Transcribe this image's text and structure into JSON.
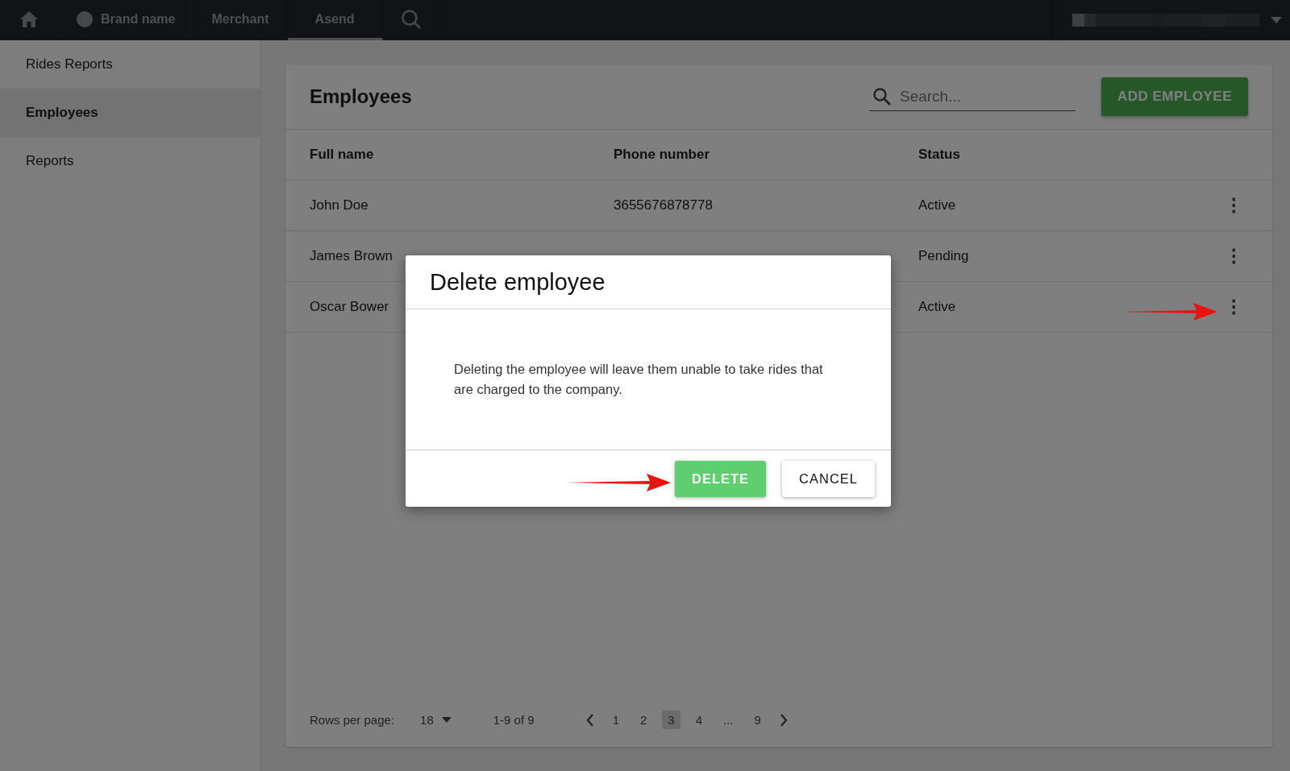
{
  "nav": {
    "brand": "Brand name",
    "tabs": [
      {
        "label": "Merchant",
        "selected": false
      },
      {
        "label": "Asend",
        "selected": true
      }
    ]
  },
  "sidebar": {
    "items": [
      {
        "label": "Rides Reports",
        "selected": false
      },
      {
        "label": "Employees",
        "selected": true
      },
      {
        "label": "Reports",
        "selected": false
      }
    ]
  },
  "page": {
    "title": "Employees",
    "search": {
      "placeholder": "Search..."
    },
    "add_button": "ADD EMPLOYEE"
  },
  "table": {
    "columns": [
      "Full name",
      "Phone number",
      "Status"
    ],
    "rows": [
      {
        "full_name": "John Doe",
        "phone": "3655676878778",
        "status": "Active"
      },
      {
        "full_name": "James Brown",
        "status": "Pending"
      },
      {
        "full_name": "Oscar Bower",
        "status": "Active"
      }
    ]
  },
  "pagination": {
    "rows_per_page_label": "Rows per page:",
    "rows_per_page": "18",
    "range": "1-9 of 9",
    "pages": [
      {
        "label": "1",
        "selected": false
      },
      {
        "label": "2",
        "selected": false
      },
      {
        "label": "3",
        "selected": true
      },
      {
        "label": "4",
        "selected": false
      },
      {
        "label": "...",
        "selected": false
      },
      {
        "label": "9",
        "selected": false
      }
    ]
  },
  "dialog": {
    "title": "Delete employee",
    "message": "Deleting the employee will leave them unable to take rides that are charged to the company.",
    "buttons": [
      {
        "label": "DELETE",
        "kind": "primary"
      },
      {
        "label": "CANCEL",
        "kind": "secondary"
      }
    ]
  }
}
